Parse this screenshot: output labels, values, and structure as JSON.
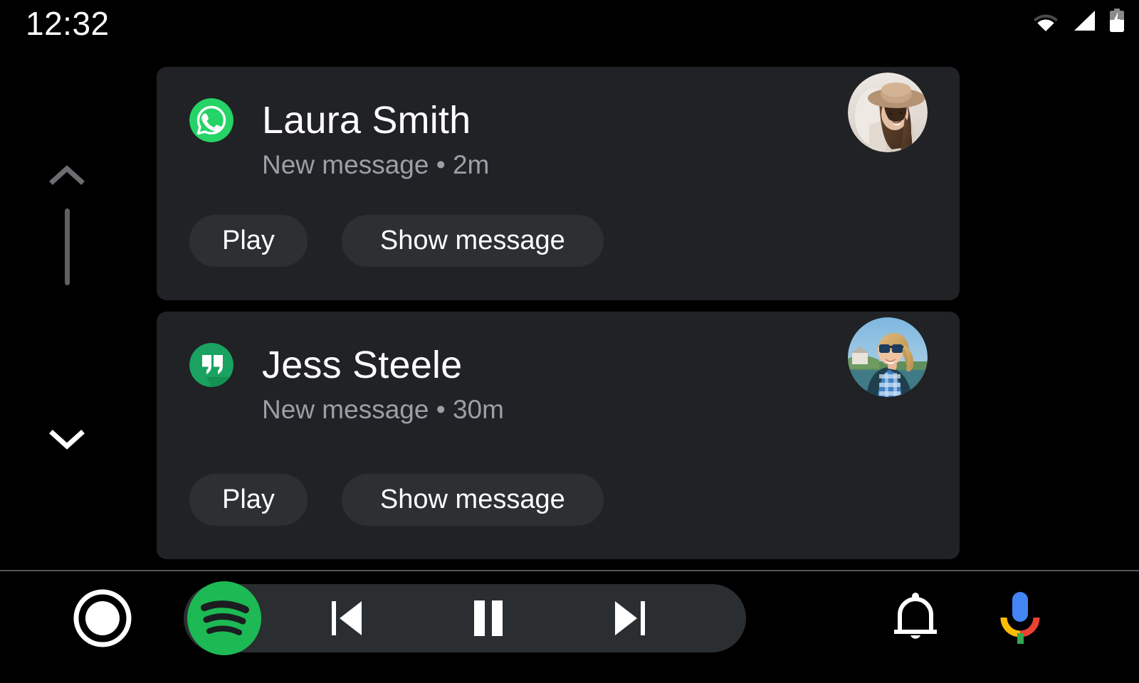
{
  "status_bar": {
    "time": "12:32",
    "icons": [
      {
        "name": "wifi-icon",
        "label": "Wi-Fi"
      },
      {
        "name": "cellular-signal-icon",
        "label": "Cellular signal"
      },
      {
        "name": "battery-charging-icon",
        "label": "Battery charging"
      }
    ]
  },
  "colors": {
    "background": "#000000",
    "card": "#202225",
    "button": "#2d3033",
    "secondary_text": "#9aa0a6",
    "whatsapp_green": "#25D366",
    "hangouts_green": "#15a05a",
    "spotify_green": "#1DB954",
    "divider": "#55585b",
    "scroll_thumb": "#5f6063",
    "chevron_inactive": "#6b6d70",
    "chevron_active": "#ffffff"
  },
  "scroll": {
    "up_label": "Scroll up",
    "down_label": "Scroll down",
    "up_enabled": "false",
    "down_enabled": "true"
  },
  "notifications": [
    {
      "app": "WhatsApp",
      "app_icon": "whatsapp-icon",
      "sender": "Laura Smith",
      "preview": "New message • 2m",
      "status": "New message",
      "time": "2m",
      "avatar_alt": "Laura Smith profile photo",
      "actions": [
        {
          "name": "play-action",
          "label": "Play"
        },
        {
          "name": "show-message-action",
          "label": "Show message"
        }
      ]
    },
    {
      "app": "Hangouts",
      "app_icon": "hangouts-icon",
      "sender": "Jess Steele",
      "preview": "New message • 30m",
      "status": "New message",
      "time": "30m",
      "avatar_alt": "Jess Steele profile photo",
      "actions": [
        {
          "name": "play-action",
          "label": "Play"
        },
        {
          "name": "show-message-action",
          "label": "Show message"
        }
      ]
    }
  ],
  "bottom_bar": {
    "home_label": "Home",
    "media": {
      "app": "Spotify",
      "app_icon": "spotify-icon",
      "previous_label": "Previous track",
      "pause_label": "Pause",
      "next_label": "Next track"
    },
    "notifications_label": "Notifications",
    "assistant_label": "Google Assistant"
  }
}
